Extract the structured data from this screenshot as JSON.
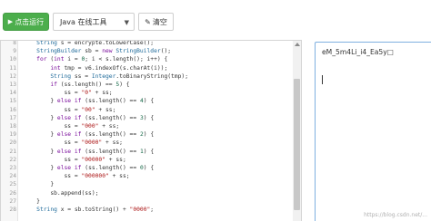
{
  "toolbar": {
    "run_label": "点击运行",
    "run_icon": "play-icon",
    "language_value": "Java 在线工具",
    "clear_label": "清空",
    "clear_icon": "eraser-icon"
  },
  "editor": {
    "lines": [
      {
        "n": "8",
        "t": "    String s = encrypte.toLowerCase();"
      },
      {
        "n": "9",
        "t": "    StringBuilder sb = new StringBuilder();"
      },
      {
        "n": "10",
        "t": "    for (int i = 0; i < s.length(); i++) {"
      },
      {
        "n": "11",
        "t": "        int tmp = v6.indexOf(s.charAt(i));"
      },
      {
        "n": "12",
        "t": "        String ss = Integer.toBinaryString(tmp);"
      },
      {
        "n": "13",
        "t": "        if (ss.length() == 5) {"
      },
      {
        "n": "14",
        "t": "            ss = \"0\" + ss;"
      },
      {
        "n": "15",
        "t": "        } else if (ss.length() == 4) {"
      },
      {
        "n": "16",
        "t": "            ss = \"00\" + ss;"
      },
      {
        "n": "17",
        "t": "        } else if (ss.length() == 3) {"
      },
      {
        "n": "18",
        "t": "            ss = \"000\" + ss;"
      },
      {
        "n": "19",
        "t": "        } else if (ss.length() == 2) {"
      },
      {
        "n": "20",
        "t": "            ss = \"0000\" + ss;"
      },
      {
        "n": "21",
        "t": "        } else if (ss.length() == 1) {"
      },
      {
        "n": "22",
        "t": "            ss = \"00000\" + ss;"
      },
      {
        "n": "23",
        "t": "        } else if (ss.length() == 0) {"
      },
      {
        "n": "24",
        "t": "            ss = \"000000\" + ss;"
      },
      {
        "n": "25",
        "t": "        }"
      },
      {
        "n": "26",
        "t": "        sb.append(ss);"
      },
      {
        "n": "27",
        "t": "    }"
      },
      {
        "n": "28",
        "t": "    String x = sb.toString() + \"0000\";"
      }
    ]
  },
  "output": {
    "text": "eM_5m4Li_i4_Ea5y□"
  },
  "watermark": "https://blog.csdn.net/..."
}
